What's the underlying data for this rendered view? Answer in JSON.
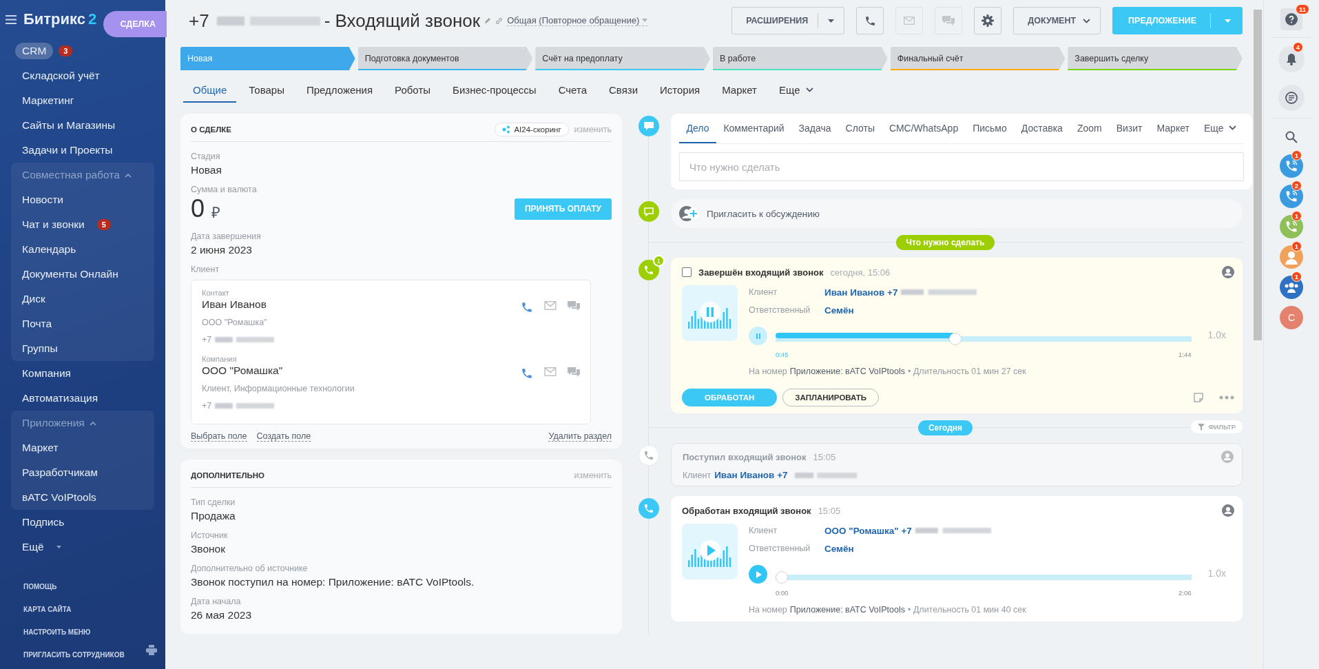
{
  "sidebar": {
    "logo_name": "Битрикс",
    "logo_suffix": "2",
    "items": [
      {
        "kind": "item",
        "label": "CRM",
        "selected": true,
        "counter": "3"
      },
      {
        "kind": "item",
        "label": "Складской учёт",
        "selected": false
      },
      {
        "kind": "item",
        "label": "Маркетинг",
        "selected": false
      },
      {
        "kind": "item",
        "label": "Сайты и Магазины",
        "selected": false
      },
      {
        "kind": "item",
        "label": "Задачи и Проекты",
        "selected": false
      },
      {
        "kind": "group",
        "label": "Совместная работа",
        "expanded": true,
        "children": [
          {
            "label": "Новости",
            "selected": false
          },
          {
            "label": "Чат и звонки",
            "selected": false,
            "counter": "5"
          },
          {
            "label": "Календарь",
            "selected": false
          },
          {
            "label": "Документы Онлайн",
            "selected": false
          },
          {
            "label": "Диск",
            "selected": false
          },
          {
            "label": "Почта",
            "selected": false
          },
          {
            "label": "Группы",
            "selected": false
          }
        ]
      },
      {
        "kind": "item",
        "label": "Компания",
        "selected": false
      },
      {
        "kind": "item",
        "label": "Автоматизация",
        "selected": false
      },
      {
        "kind": "group",
        "label": "Приложения",
        "expanded": true,
        "children": [
          {
            "label": "Маркет",
            "selected": false
          },
          {
            "label": "Разработчикам",
            "selected": false
          },
          {
            "label": "вАТС VoIPtools",
            "selected": false
          }
        ]
      },
      {
        "kind": "item",
        "label": "Подпись",
        "selected": false
      },
      {
        "kind": "more",
        "label": "Ещё"
      }
    ],
    "footer_links": [
      "ПОМОЩЬ",
      "КАРТА САЙТА",
      "НАСТРОИТЬ МЕНЮ",
      "ПРИГЛАСИТЬ СОТРУДНИКОВ"
    ]
  },
  "slider_tab": {
    "label": "СДЕЛКА"
  },
  "header": {
    "title_prefix": "+7",
    "title_rest": "- Входящий звонок",
    "category": "Общая (Повторное обращение)",
    "buttons": [
      {
        "kind": "split",
        "label": "РАСШИРЕНИЯ"
      },
      {
        "kind": "phone",
        "disabled": false
      },
      {
        "kind": "mail",
        "disabled": true
      },
      {
        "kind": "chat",
        "disabled": true
      },
      {
        "kind": "gear",
        "disabled": false
      },
      {
        "kind": "dropdown",
        "label": "ДОКУМЕНТ"
      },
      {
        "kind": "primary",
        "label": "ПРЕДЛОЖЕНИЕ"
      }
    ]
  },
  "stages": [
    {
      "label": "Новая",
      "selected": true,
      "color": "#3ea8ea"
    },
    {
      "label": "Подготовка документов",
      "selected": false,
      "color": "#39b7ee"
    },
    {
      "label": "Счёт на предоплату",
      "selected": false,
      "color": "#3bc8f5"
    },
    {
      "label": "В работе",
      "selected": false,
      "color": "#47e4c2"
    },
    {
      "label": "Финальный счёт",
      "selected": false,
      "color": "#ffa900"
    },
    {
      "label": "Завершить сделку",
      "selected": false,
      "color": "#7bd500"
    }
  ],
  "tabs": [
    {
      "kind": "tab",
      "label": "Общие",
      "selected": true
    },
    {
      "kind": "tab",
      "label": "Товары",
      "selected": false
    },
    {
      "kind": "tab",
      "label": "Предложения",
      "selected": false
    },
    {
      "kind": "tab",
      "label": "Роботы",
      "selected": false
    },
    {
      "kind": "tab",
      "label": "Бизнес-процессы",
      "selected": false
    },
    {
      "kind": "tab",
      "label": "Счета",
      "selected": false
    },
    {
      "kind": "tab",
      "label": "Связи",
      "selected": false
    },
    {
      "kind": "tab",
      "label": "История",
      "selected": false
    },
    {
      "kind": "tab",
      "label": "Маркет",
      "selected": false
    },
    {
      "kind": "more",
      "label": "Еще",
      "selected": false
    }
  ],
  "deal_card": {
    "title": "О СДЕЛКЕ",
    "ai_badge": "AI24-скоринг",
    "edit": "изменить",
    "fields": [
      {
        "kind": "text",
        "label": "Стадия",
        "value": "Новая"
      },
      {
        "kind": "amount",
        "label": "Сумма и валюта",
        "value": "0",
        "currency": "₽",
        "button": "ПРИНЯТЬ ОПЛАТУ"
      },
      {
        "kind": "text",
        "label": "Дата завершения",
        "value": "2 июня 2023"
      },
      {
        "kind": "client",
        "label": "Клиент",
        "entries": [
          {
            "type_label": "Контакт",
            "name": "Иван Иванов",
            "detail": "ООО \"Ромашка\"",
            "phone_prefix": "+7"
          },
          {
            "type_label": "Компания",
            "name": "ООО \"Ромашка\"",
            "detail": "Клиент, Информационные технологии",
            "phone_prefix": "+7"
          }
        ]
      }
    ],
    "footer_links": [
      "Выбрать поле",
      "Создать поле"
    ],
    "delete_link": "Удалить раздел"
  },
  "extra_card": {
    "title": "ДОПОЛНИТЕЛЬНО",
    "edit": "изменить",
    "fields": [
      {
        "label": "Тип сделки",
        "value": "Продажа"
      },
      {
        "label": "Источник",
        "value": "Звонок"
      },
      {
        "label": "Дополнительно об источнике",
        "value": "Звонок поступил на номер: Приложение: вАТС VoIPtools."
      },
      {
        "label": "Дата начала",
        "value": "26 мая 2023"
      }
    ]
  },
  "timeline": {
    "composer": {
      "color": "#3bc8f5",
      "tabs": [
        {
          "label": "Дело",
          "selected": true
        },
        {
          "label": "Комментарий",
          "selected": false
        },
        {
          "label": "Задача",
          "selected": false
        },
        {
          "label": "Слоты",
          "selected": false
        },
        {
          "label": "СМС/WhatsApp",
          "selected": false
        },
        {
          "label": "Письмо",
          "selected": false
        },
        {
          "label": "Доставка",
          "selected": false
        },
        {
          "label": "Zoom",
          "selected": false
        },
        {
          "label": "Визит",
          "selected": false
        },
        {
          "label": "Маркет",
          "selected": false
        }
      ],
      "more": "Еще",
      "placeholder": "Что нужно сделать"
    },
    "invite": {
      "color": "#9dcf00",
      "label": "Пригласить к обсуждению"
    },
    "planned_label": "Что нужно сделать",
    "planned": [
      {
        "kind": "call",
        "color": "#9dcf00",
        "badge": "1",
        "checked": false,
        "title": "Завершён входящий звонок",
        "time": "сегодня, 15:06",
        "rows": [
          {
            "label": "Клиент",
            "value": "Иван Иванов +7"
          },
          {
            "label": "Ответственный",
            "value": "Семён"
          }
        ],
        "player": {
          "playing": true,
          "level": 0.43,
          "start": "0:45",
          "end": "1:44",
          "speed": "1.0x"
        },
        "note_prefix": "На номер",
        "note_value": "Приложение: вАТС VoIPtools",
        "note_duration": "• Длительность 01 мин 27 сек",
        "buttons": [
          "ОБРАБОТАН",
          "ЗАПЛАНИРОВАТЬ"
        ]
      }
    ],
    "history_label": "Сегодня",
    "filter": "ФИЛЬТР",
    "history": [
      {
        "kind": "brief",
        "color": "#ffffff",
        "title": "Поступил входящий звонок",
        "time": "15:05",
        "client_label": "Клиент",
        "client_value": "Иван Иванов +7"
      },
      {
        "kind": "call",
        "color": "#3bc8f5",
        "title": "Обработан входящий звонок",
        "time": "15:05",
        "rows": [
          {
            "label": "Клиент",
            "value": "ООО \"Ромашка\" +7"
          },
          {
            "label": "Ответственный",
            "value": "Семён"
          }
        ],
        "player": {
          "playing": false,
          "level": 0,
          "start": "0:00",
          "end": "2:06",
          "speed": "1.0x"
        },
        "note_prefix": "На номер",
        "note_value": "Приложение: вАТС VoIPtools",
        "note_duration": "• Длительность 01 мин 40 сек"
      }
    ]
  },
  "right_bar": [
    {
      "kind": "help",
      "counter": "11"
    },
    {
      "kind": "bell",
      "counter": "4"
    },
    {
      "kind": "chats"
    },
    {
      "kind": "search"
    },
    {
      "kind": "call",
      "color": "#3a9be0",
      "counter": "1"
    },
    {
      "kind": "call",
      "color": "#3a9be0",
      "counter": "2"
    },
    {
      "kind": "call",
      "color": "#8fbf57",
      "counter": "1"
    },
    {
      "kind": "avatar",
      "color": "#f0a15a",
      "counter": "1"
    },
    {
      "kind": "group",
      "color": "#2f72c4",
      "counter": "1"
    },
    {
      "kind": "initial",
      "color": "#e4826e",
      "label": "С"
    }
  ]
}
